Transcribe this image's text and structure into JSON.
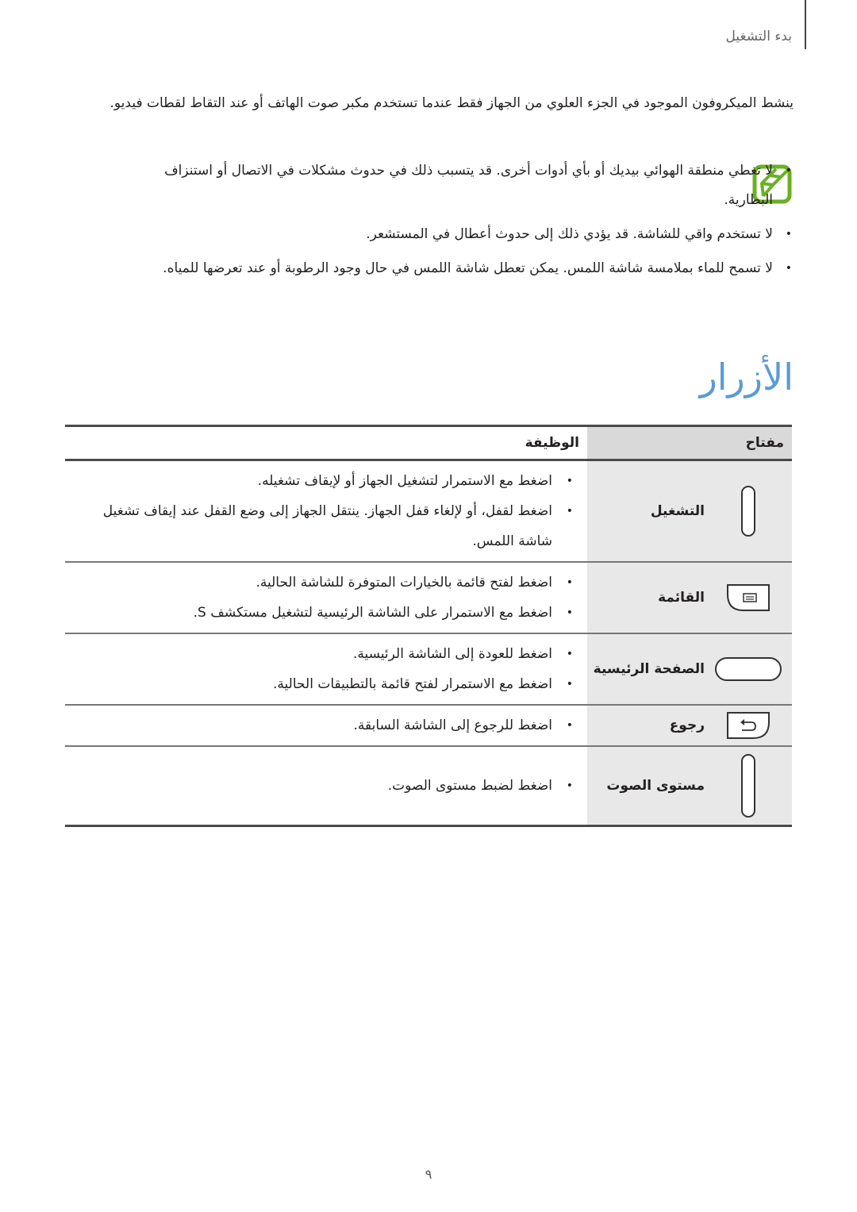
{
  "header": {
    "section_label": "بدء التشغيل"
  },
  "intro": {
    "paragraph": "ينشط الميكروفون الموجود في الجزء العلوي من الجهاز فقط عندما تستخدم مكبر صوت الهاتف أو عند التقاط لقطات فيديو."
  },
  "notes": {
    "icon": "note-pencil-icon",
    "icon_color": "#6ab023",
    "items": [
      "لا تغطي منطقة الهوائي بيديك أو بأي أدوات أخرى. قد يتسبب ذلك في حدوث مشكلات في الاتصال أو استنزاف البطارية.",
      "لا تستخدم واقي للشاشة. قد يؤدي ذلك إلى حدوث أعطال في المستشعر.",
      "لا تسمح للماء بملامسة شاشة اللمس. يمكن تعطل شاشة اللمس في حال وجود الرطوبة أو عند تعرضها للمياه."
    ]
  },
  "title": {
    "text": "الأزرار",
    "color": "#5a9bd5"
  },
  "table": {
    "headers": {
      "key": "مفتاح",
      "function": "الوظيفة"
    },
    "rows": [
      {
        "key": "التشغيل",
        "icon": "power-key-icon",
        "functions": [
          "اضغط مع الاستمرار لتشغيل الجهاز أو لإيقاف تشغيله.",
          "اضغط لقفل، أو لإلغاء قفل الجهاز. ينتقل الجهاز إلى وضع القفل عند إيقاف تشغيل شاشة اللمس."
        ]
      },
      {
        "key": "القائمة",
        "icon": "menu-key-icon",
        "functions": [
          "اضغط لفتح قائمة بالخيارات المتوفرة للشاشة الحالية.",
          "اضغط مع الاستمرار على الشاشة الرئيسية لتشغيل مستكشف S."
        ]
      },
      {
        "key": "الصفحة الرئيسية",
        "icon": "home-key-icon",
        "functions": [
          "اضغط للعودة إلى الشاشة الرئيسية.",
          "اضغط مع الاستمرار لفتح قائمة بالتطبيقات الحالية."
        ]
      },
      {
        "key": "رجوع",
        "icon": "back-key-icon",
        "functions": [
          "اضغط للرجوع إلى الشاشة السابقة."
        ]
      },
      {
        "key": "مستوى الصوت",
        "icon": "volume-key-icon",
        "functions": [
          "اضغط لضبط مستوى الصوت."
        ]
      }
    ]
  },
  "footer": {
    "page_number": "٩"
  }
}
